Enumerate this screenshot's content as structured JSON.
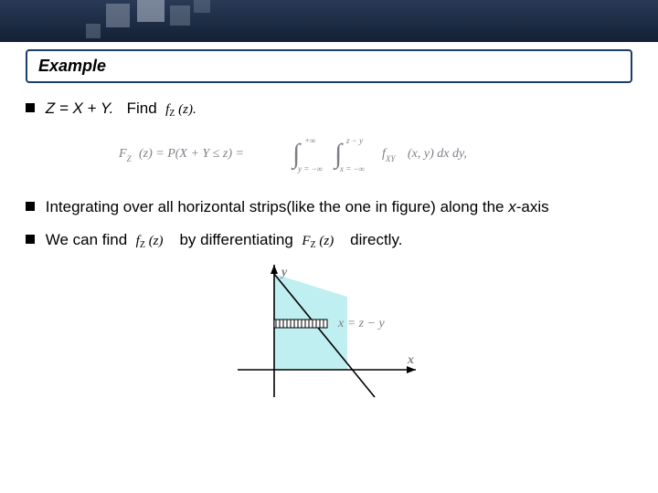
{
  "header": {
    "box_title": "Example"
  },
  "b1": {
    "prefix": "Z = X + Y.",
    "find": "Find",
    "f_target": "f",
    "f_target_sub": "Z",
    "f_target_arg": "(z)."
  },
  "eq": {
    "Fz": "F",
    "Fz_sub": "Z",
    "Fz_arg": "(z) = P(X + Y ≤ z) =",
    "int1_low": "y = −∞",
    "int1_up": "+∞",
    "int2_low": "x = −∞",
    "int2_up": "z − y",
    "fxy": "f",
    "fxy_sub": "XY",
    "fxy_arg": "(x, y) dx dy,"
  },
  "b2": {
    "text": "Integrating over all horizontal strips(like the one in figure) along the ",
    "axis": "x",
    "suffix": "-axis"
  },
  "b3": {
    "prefix": "We can find",
    "f1": "f",
    "f1_sub": "Z",
    "f1_arg": "(z)",
    "mid": "by differentiating",
    "F2": "F",
    "F2_sub": "Z",
    "F2_arg": "(z)",
    "suffix": "directly."
  },
  "figure": {
    "ylabel": "y",
    "xlabel": "x",
    "linelabel": "x = z − y"
  }
}
